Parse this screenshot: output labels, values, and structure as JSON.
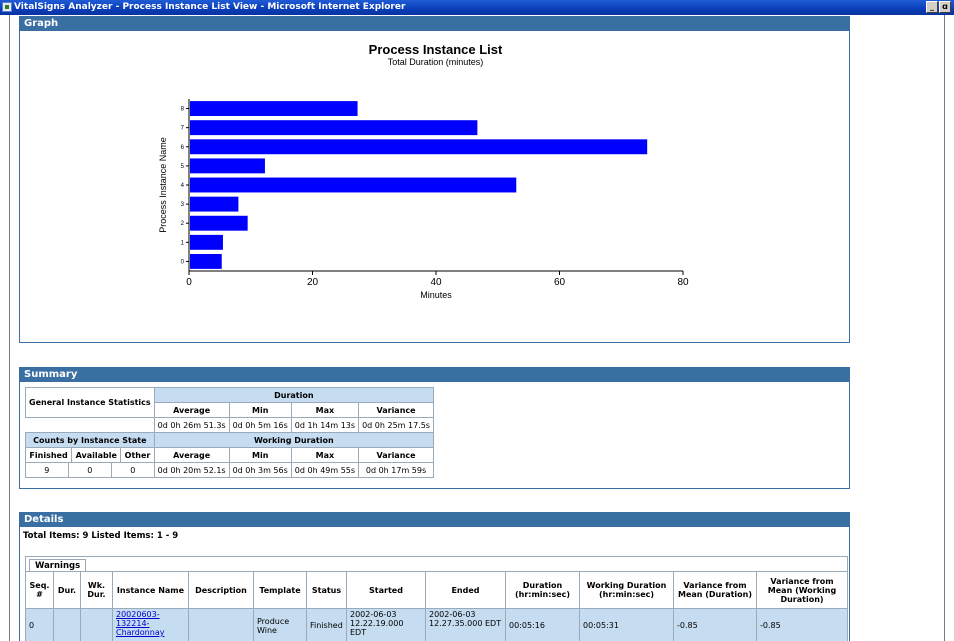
{
  "window": {
    "title": "VitalSigns Analyzer - Process Instance List View - Microsoft Internet Explorer",
    "minimize": "_",
    "restore": "ɑ"
  },
  "graph": {
    "header": "Graph"
  },
  "chart_data": {
    "type": "bar",
    "orientation": "horizontal",
    "title": "Process Instance List",
    "subtitle": "Total Duration (minutes)",
    "xlabel": "Minutes",
    "ylabel": "Process Instance Name",
    "xlim": [
      0,
      80
    ],
    "xticks": [
      "0",
      "20",
      "40",
      "60",
      "80"
    ],
    "categories": [
      "0",
      "1",
      "2",
      "3",
      "4",
      "5",
      "6",
      "7",
      "8"
    ],
    "values": [
      5.3,
      5.5,
      9.5,
      8.0,
      53.0,
      12.3,
      74.2,
      46.7,
      27.3
    ],
    "bar_color": "#0000ff",
    "grid": false
  },
  "summary": {
    "header": "Summary",
    "general_label": "General Instance Statistics",
    "duration_label": "Duration",
    "working_duration_label": "Working Duration",
    "counts_label": "Counts by Instance State",
    "stat_cols": [
      "Average",
      "Min",
      "Max",
      "Variance"
    ],
    "state_cols": [
      "Finished",
      "Available",
      "Other"
    ],
    "duration": [
      "0d 0h 26m 51.3s",
      "0d 0h 5m 16s",
      "0d 1h 14m 13s",
      "0d 0h 25m 17.5s"
    ],
    "working": [
      "0d 0h 20m 52.1s",
      "0d 0h 3m 56s",
      "0d 0h 49m 55s",
      "0d 0h 17m 59s"
    ],
    "counts": [
      "9",
      "0",
      "0"
    ]
  },
  "details": {
    "header": "Details",
    "meta": "Total Items: 9   Listed Items: 1 - 9",
    "tab": "Warnings",
    "columns": [
      "Seq. #",
      "Dur.",
      "Wk. Dur.",
      "Instance Name",
      "Description",
      "Template",
      "Status",
      "Started",
      "Ended",
      "Duration (hr:min:sec)",
      "Working Duration (hr:min:sec)",
      "Variance from Mean (Duration)",
      "Variance from Mean (Working Duration)"
    ],
    "rows": [
      {
        "seq": "0",
        "dur": "",
        "wkdur": "",
        "name": "20020603-132214-Chardonnay",
        "description": "",
        "template": "Produce Wine",
        "status": "Finished",
        "started": "2002-06-03 12.22.19.000 EDT",
        "ended": "2002-06-03 12.27.35.000 EDT",
        "duration": "00:05:16",
        "working": "00:05:31",
        "var_dur": "-0.85",
        "var_work": "-0.85"
      }
    ]
  }
}
